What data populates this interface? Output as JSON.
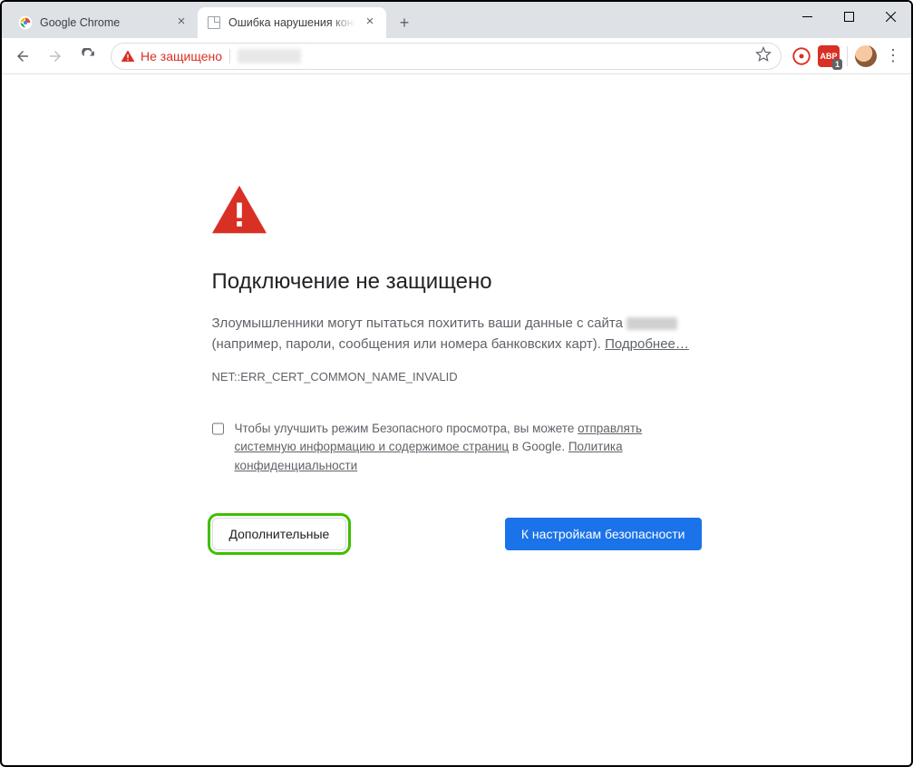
{
  "window": {
    "tabs": [
      {
        "title": "Google Chrome",
        "active": false
      },
      {
        "title": "Ошибка нарушения конфиденц",
        "active": true
      }
    ]
  },
  "toolbar": {
    "not_secure_label": "Не защищено"
  },
  "extensions": {
    "abp_label": "ABP",
    "abp_count": "1"
  },
  "interstitial": {
    "heading": "Подключение не защищено",
    "body_prefix": "Злоумышленники могут пытаться похитить ваши данные с сайта ",
    "body_suffix": " (например, пароли, сообщения или номера банковских карт). ",
    "learn_more": "Подробнее…",
    "error_code": "NET::ERR_CERT_COMMON_NAME_INVALID",
    "optin_prefix": "Чтобы улучшить режим Безопасного просмотра, вы можете ",
    "optin_link1": "отправлять системную информацию и содержимое страниц",
    "optin_middle": " в Google. ",
    "optin_link2": "Политика конфиденциальности",
    "btn_advanced": "Дополнительные",
    "btn_back": "К настройкам безопасности"
  }
}
